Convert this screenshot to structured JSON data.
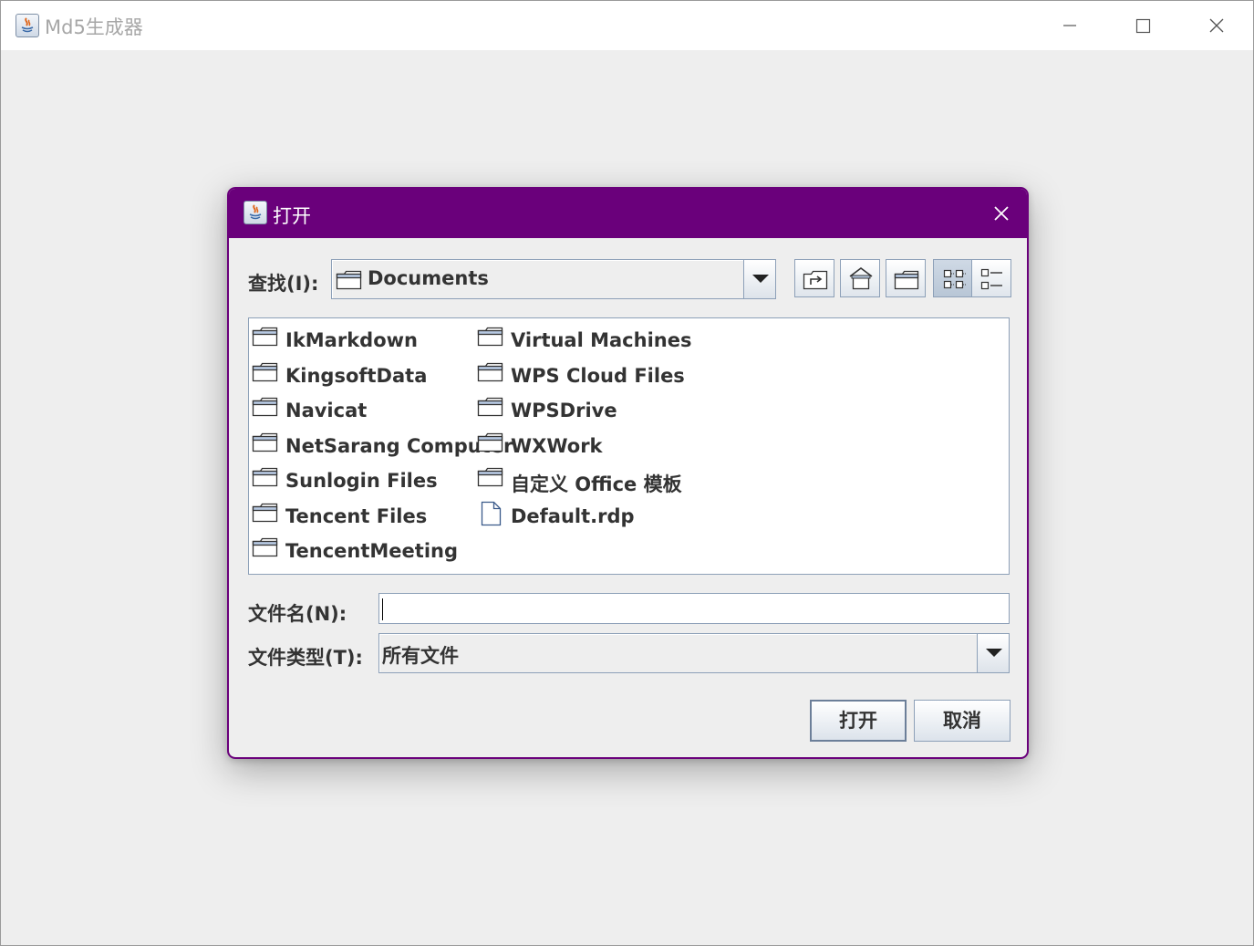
{
  "main_window": {
    "title": "Md5生成器"
  },
  "dialog": {
    "title": "打开",
    "look_in": {
      "label": "查找(I):",
      "value": "Documents"
    },
    "toolbar": {
      "icons": [
        "up-one-level-icon",
        "home-icon",
        "new-folder-icon",
        "list-view-icon",
        "details-view-icon"
      ],
      "active_view": "list"
    },
    "files": [
      {
        "name": "IkMarkdown",
        "type": "folder"
      },
      {
        "name": "KingsoftData",
        "type": "folder"
      },
      {
        "name": "Navicat",
        "type": "folder"
      },
      {
        "name": "NetSarang Computer",
        "type": "folder"
      },
      {
        "name": "Sunlogin Files",
        "type": "folder"
      },
      {
        "name": "Tencent Files",
        "type": "folder"
      },
      {
        "name": "TencentMeeting",
        "type": "folder"
      },
      {
        "name": "Virtual Machines",
        "type": "folder"
      },
      {
        "name": "WPS Cloud Files",
        "type": "folder"
      },
      {
        "name": "WPSDrive",
        "type": "folder"
      },
      {
        "name": "WXWork",
        "type": "folder"
      },
      {
        "name": "自定义 Office 模板",
        "type": "folder"
      },
      {
        "name": "Default.rdp",
        "type": "file"
      }
    ],
    "file_name": {
      "label": "文件名(N):",
      "value": ""
    },
    "file_type": {
      "label": "文件类型(T):",
      "value": "所有文件"
    },
    "buttons": {
      "open": "打开",
      "cancel": "取消"
    }
  },
  "colors": {
    "dialog_accent": "#6a007b",
    "window_background": "#eeeeee",
    "control_border": "#8da0b8"
  }
}
